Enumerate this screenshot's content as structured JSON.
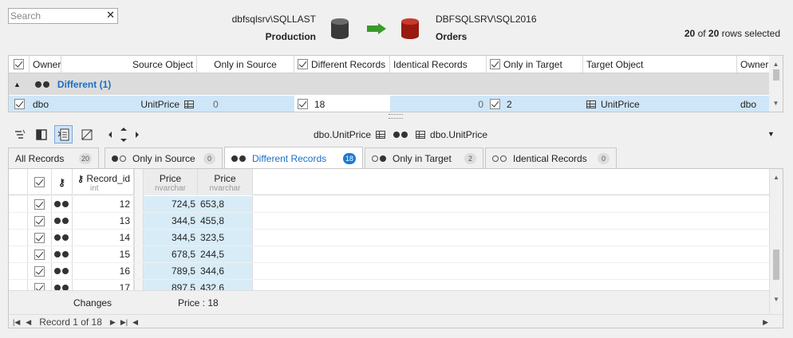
{
  "search": {
    "placeholder": "Search"
  },
  "source": {
    "server": "dbfsqlsrv\\SQLLAST",
    "db": "Production"
  },
  "target": {
    "server": "DBFSQLSRV\\SQL2016",
    "db": "Orders"
  },
  "selection": {
    "count": "20",
    "of": "of",
    "total": "20",
    "suffix": "rows selected"
  },
  "top_grid": {
    "headers": {
      "owner": "Owner",
      "source_object": "Source Object",
      "only_in_source": "Only in Source",
      "different": "Different Records",
      "identical": "Identical Records",
      "only_in_target": "Only in Target",
      "target_object": "Target Object",
      "owner2": "Owner"
    },
    "group": "Different (1)",
    "row": {
      "owner": "dbo",
      "source_object": "UnitPrice",
      "only_in_source": "0",
      "different": "18",
      "identical": "0",
      "only_in_target": "2",
      "target_object": "UnitPrice",
      "owner2": "dbo"
    }
  },
  "compare_bar": {
    "left": "dbo.UnitPrice",
    "right": "dbo.UnitPrice"
  },
  "tabs": [
    {
      "label": "All Records",
      "count": "20"
    },
    {
      "label": "Only in Source",
      "count": "0"
    },
    {
      "label": "Different Records",
      "count": "18"
    },
    {
      "label": "Only in Target",
      "count": "2"
    },
    {
      "label": "Identical Records",
      "count": "0"
    }
  ],
  "detail_grid": {
    "headers": {
      "record_id": "Record_id",
      "record_id_type": "int",
      "price_src": "Price",
      "price_src_type": "nvarchar",
      "price_tgt": "Price",
      "price_tgt_type": "nvarchar"
    },
    "rows": [
      {
        "id": "12",
        "src": "724,5",
        "tgt": "653,8"
      },
      {
        "id": "13",
        "src": "344,5",
        "tgt": "455,8"
      },
      {
        "id": "14",
        "src": "344,5",
        "tgt": "323,5"
      },
      {
        "id": "15",
        "src": "678,5",
        "tgt": "244,5"
      },
      {
        "id": "16",
        "src": "789,5",
        "tgt": "344,6"
      },
      {
        "id": "17",
        "src": "897,5",
        "tgt": "432,6"
      }
    ],
    "footer": {
      "changes_label": "Changes",
      "price_summary": "Price : 18"
    }
  },
  "navigator": {
    "record_text": "Record 1 of 18"
  }
}
